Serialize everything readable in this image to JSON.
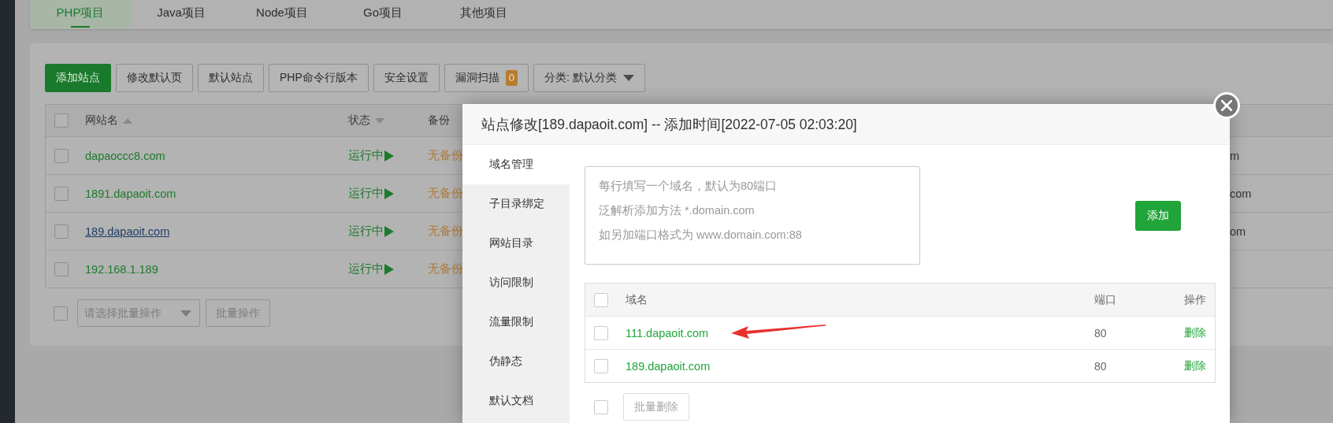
{
  "tabs": [
    {
      "label": "PHP项目",
      "selected": true
    },
    {
      "label": "Java项目",
      "selected": false
    },
    {
      "label": "Node项目",
      "selected": false
    },
    {
      "label": "Go项目",
      "selected": false
    },
    {
      "label": "其他项目",
      "selected": false
    }
  ],
  "toolbar": [
    {
      "label": "添加站点",
      "kind": "primary"
    },
    {
      "label": "修改默认页",
      "kind": "plain"
    },
    {
      "label": "默认站点",
      "kind": "plain"
    },
    {
      "label": "PHP命令行版本",
      "kind": "plain"
    },
    {
      "label": "安全设置",
      "kind": "plain"
    },
    {
      "label": "漏洞扫描",
      "kind": "badge",
      "badge": "0"
    },
    {
      "label": "分类: 默认分类",
      "kind": "dropdown"
    }
  ],
  "sites_table": {
    "header_checked": false,
    "columns": [
      {
        "label": "网站名",
        "sorted": true,
        "descending": false
      },
      {
        "label": "状态",
        "sorted": true,
        "descending": true
      },
      {
        "label": "备份"
      }
    ],
    "rows": [
      {
        "checked": false,
        "name": "dapaoccc8.com",
        "hovered": false,
        "status": "运行中",
        "backup": "无备份",
        "column_4": "m"
      },
      {
        "checked": false,
        "name": "1891.dapaoit.com",
        "hovered": false,
        "status": "运行中",
        "backup": "无备份",
        "column_4": "com"
      },
      {
        "checked": false,
        "name": "189.dapaoit.com",
        "hovered": true,
        "status": "运行中",
        "backup": "无备份",
        "column_4": "om"
      },
      {
        "checked": false,
        "name": "192.168.1.189",
        "hovered": false,
        "status": "运行中",
        "backup": "无备份"
      }
    ]
  },
  "batch": {
    "checked": false,
    "select_placeholder": "请选择批量操作",
    "button": "批量操作",
    "disabled": true
  },
  "dialog": {
    "title": "站点修改[189.dapaoit.com] -- 添加时间[2022-07-05 02:03:20]",
    "nav": [
      {
        "label": "域名管理",
        "selected": true
      },
      {
        "label": "子目录绑定",
        "selected": false
      },
      {
        "label": "网站目录",
        "selected": false
      },
      {
        "label": "访问限制",
        "selected": false
      },
      {
        "label": "流量限制",
        "selected": false
      },
      {
        "label": "伪静态",
        "selected": false
      },
      {
        "label": "默认文档",
        "selected": false
      }
    ],
    "domain_input": {
      "placeholder": [
        "每行填写一个域名，默认为80端口",
        "泛解析添加方法 *.domain.com",
        "如另加端口格式为 www.domain.com:88"
      ]
    },
    "add_button": "添加",
    "domains": {
      "header_checked": false,
      "columns": [
        "域名",
        "端口",
        "操作"
      ],
      "rows": [
        {
          "checked": false,
          "domain": "111.dapaoit.com",
          "port": "80",
          "action": "删除"
        },
        {
          "checked": false,
          "domain": "189.dapaoit.com",
          "port": "80",
          "action": "删除"
        }
      ]
    },
    "batch_checked": false,
    "batch_delete": {
      "label": "批量删除",
      "disabled": true
    }
  }
}
